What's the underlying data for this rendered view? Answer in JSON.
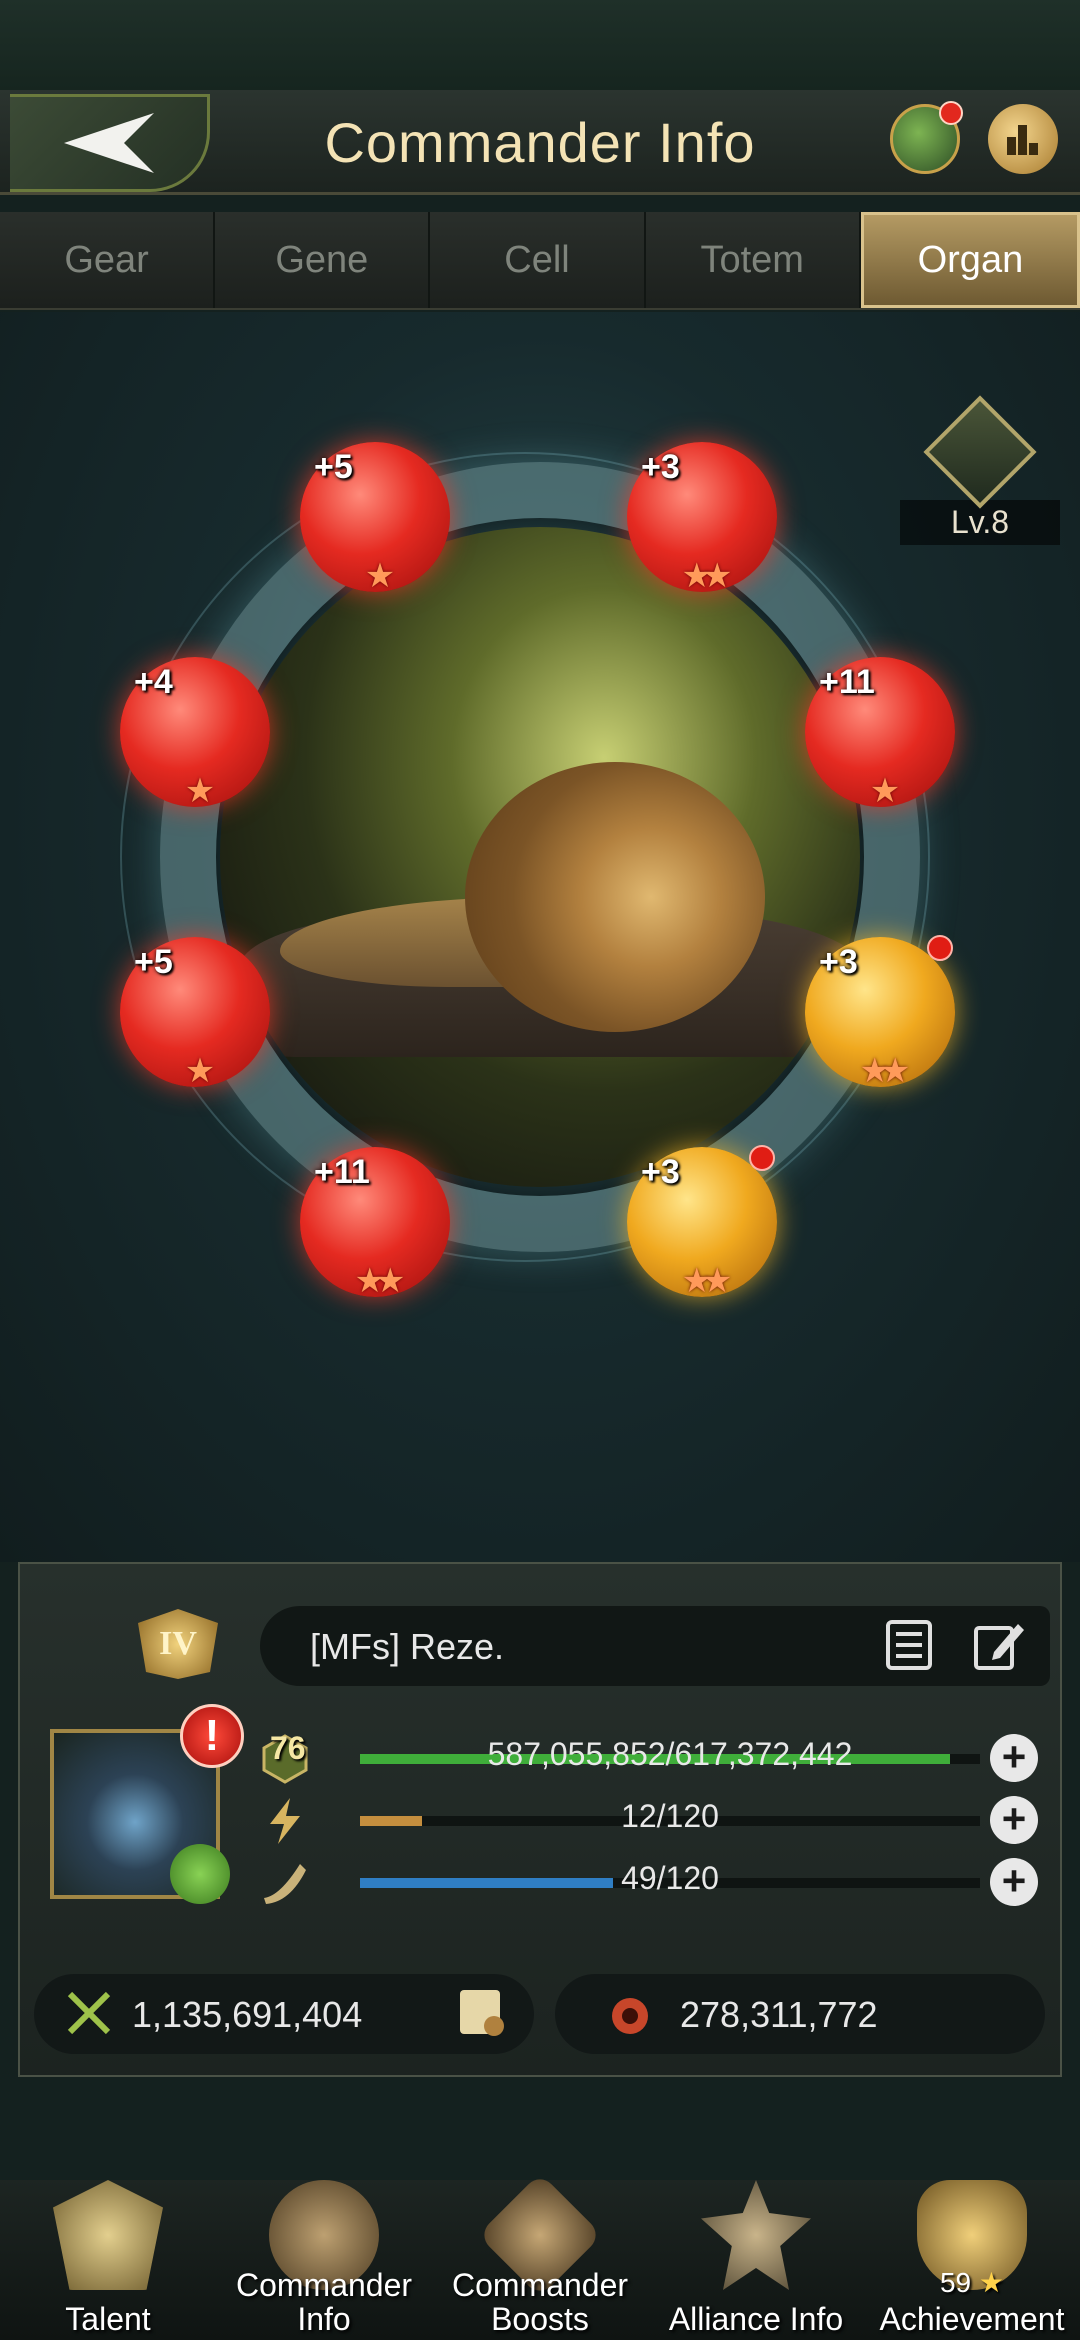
{
  "header": {
    "title": "Commander Info",
    "back_icon": "back-arrow-icon",
    "profile_icon": "commander-profile-icon",
    "rank_icon": "ranking-icon"
  },
  "tabs": [
    {
      "label": "Gear",
      "active": false
    },
    {
      "label": "Gene",
      "active": false
    },
    {
      "label": "Cell",
      "active": false
    },
    {
      "label": "Totem",
      "active": false
    },
    {
      "label": "Organ",
      "active": true
    }
  ],
  "organs": [
    {
      "level": "+5",
      "stars": "★",
      "color": "red",
      "notify": false
    },
    {
      "level": "+3",
      "stars": "★★",
      "color": "red",
      "notify": false
    },
    {
      "level": "+4",
      "stars": "★",
      "color": "red",
      "notify": false
    },
    {
      "level": "+11",
      "stars": "★",
      "color": "red",
      "notify": false
    },
    {
      "level": "+5",
      "stars": "★",
      "color": "red",
      "notify": false
    },
    {
      "level": "+3",
      "stars": "★★",
      "color": "gold",
      "notify": true
    },
    {
      "level": "+11",
      "stars": "★★",
      "color": "red",
      "notify": false
    },
    {
      "level": "+3",
      "stars": "★★",
      "color": "gold",
      "notify": true
    }
  ],
  "organ_system_level": "Lv.8",
  "commander": {
    "rank": "IV",
    "name": "[MFs]  Reze.",
    "level": "76",
    "alert": "!",
    "stats": [
      {
        "icon": "experience-icon",
        "value": "587,055,852/617,372,442",
        "fill": 0.951,
        "color": "#3fae3a"
      },
      {
        "icon": "energy-icon",
        "value": "12/120",
        "fill": 0.1,
        "color": "#c58e3e"
      },
      {
        "icon": "stamina-horn-icon",
        "value": "49/120",
        "fill": 0.408,
        "color": "#2f7ec4"
      }
    ],
    "power": "1,135,691,404",
    "kills": "278,311,772"
  },
  "bottom_nav": [
    {
      "label": "Talent",
      "icon": "talent-crown-icon"
    },
    {
      "label": "Commander Info",
      "icon": "commander-info-icon"
    },
    {
      "label": "Commander Boosts",
      "icon": "commander-boosts-icon"
    },
    {
      "label": "Alliance Info",
      "icon": "alliance-info-icon"
    },
    {
      "label": "Achievement",
      "icon": "achievement-icon",
      "count": "59"
    }
  ]
}
